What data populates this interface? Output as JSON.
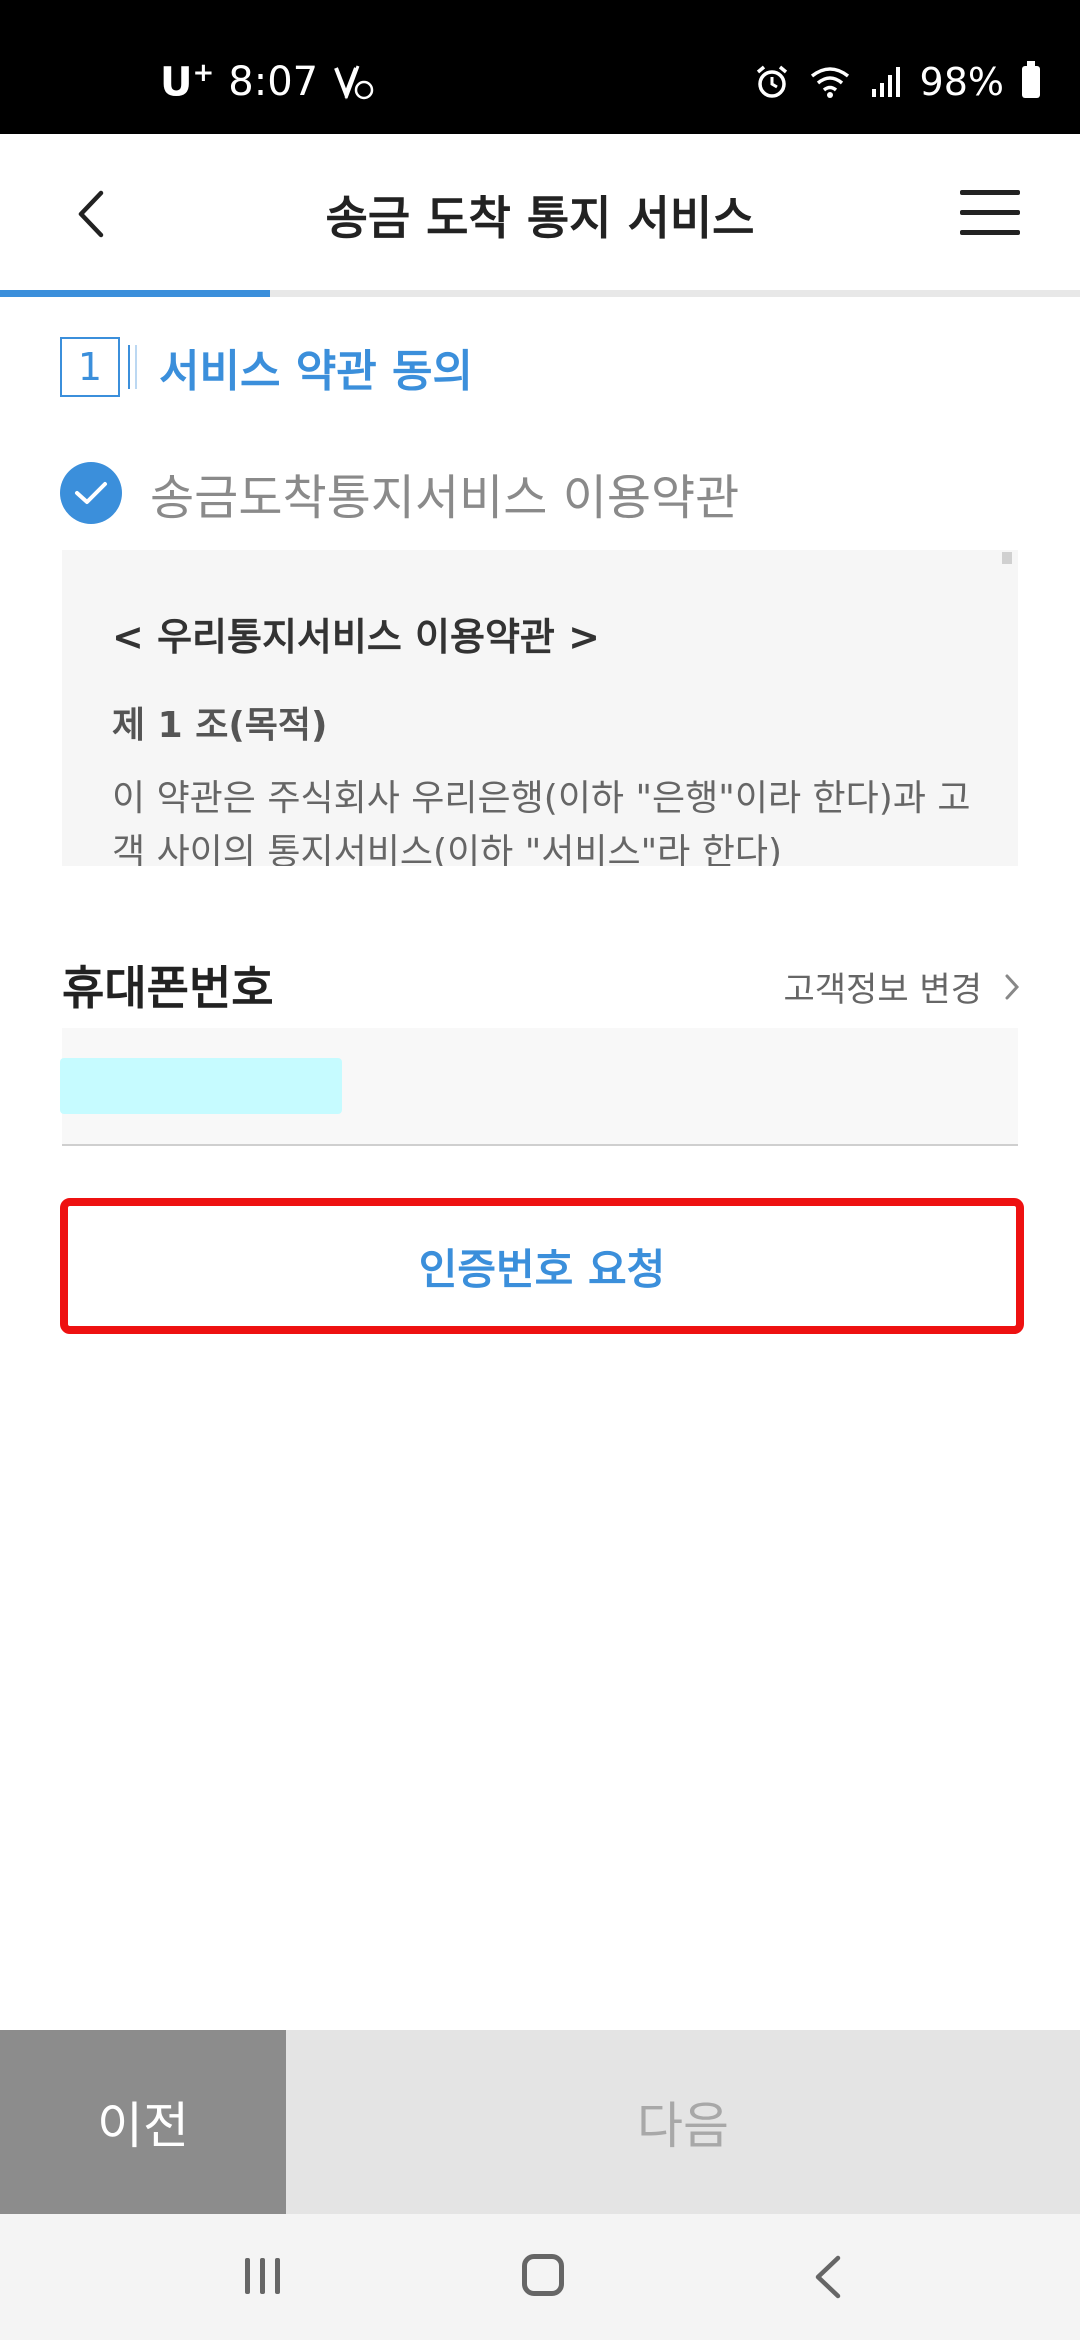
{
  "status_bar": {
    "carrier": "U",
    "carrier_sup": "+",
    "time": "8:07",
    "battery": "98%"
  },
  "header": {
    "title": "송금 도착 통지 서비스",
    "progress_fraction": 0.25
  },
  "step": {
    "number": "1",
    "title": "서비스 약관 동의"
  },
  "agreement": {
    "label": "송금도착통지서비스 이용약관",
    "checked": true,
    "terms_heading": "< 우리통지서비스 이용약관 >",
    "terms_article": "제 1 조(목적)",
    "terms_body": "이 약관은 주식회사 우리은행(이하 \"은행\"이라 한다)과 고객 사이의 통지서비스(이하 \"서비스\"라 한다)"
  },
  "phone": {
    "label": "휴대폰번호",
    "change_link": "고객정보 변경"
  },
  "request_button": {
    "label": "인증번호 요청"
  },
  "bottom_buttons": {
    "prev": "이전",
    "next": "다음"
  },
  "colors": {
    "accent": "#3b8fdb",
    "highlight_border": "#ee1111"
  }
}
